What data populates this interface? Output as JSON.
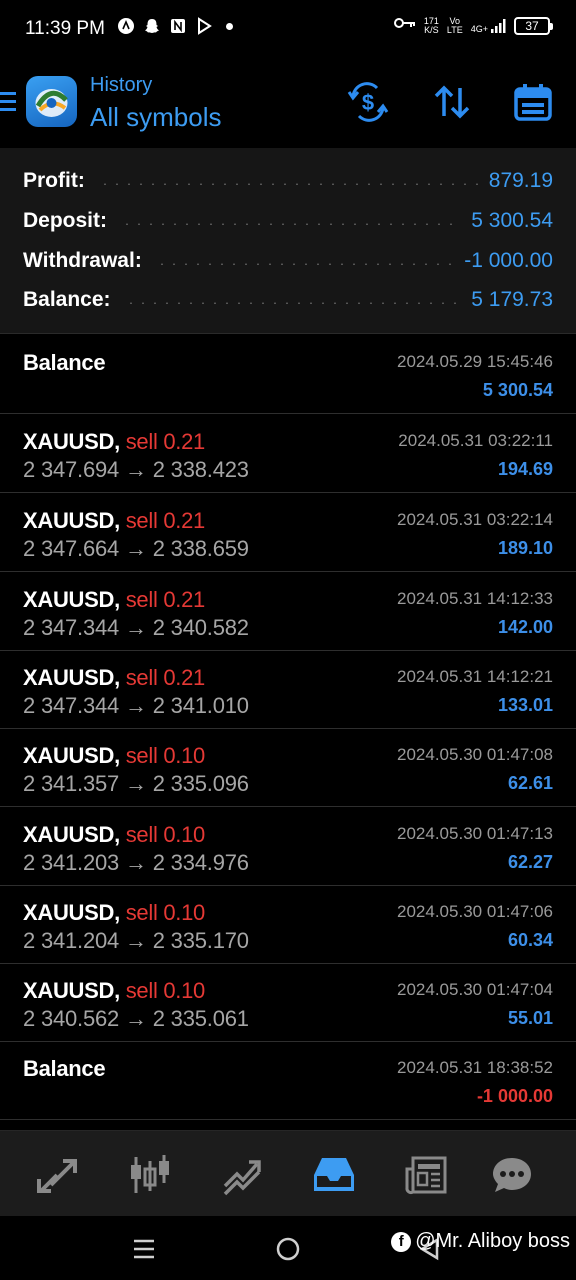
{
  "status_bar": {
    "time": "11:39 PM",
    "net_speed_top": "171",
    "net_speed_unit": "K/S",
    "volte_top": "Vo",
    "volte_bottom": "LTE",
    "network": "4G+",
    "battery": "37"
  },
  "header": {
    "subtitle": "History",
    "title": "All symbols"
  },
  "summary": [
    {
      "label": "Profit:",
      "value": "879.19"
    },
    {
      "label": "Deposit:",
      "value": "5 300.54"
    },
    {
      "label": "Withdrawal:",
      "value": "-1 000.00"
    },
    {
      "label": "Balance:",
      "value": "5 179.73"
    }
  ],
  "entries": [
    {
      "type": "balance",
      "title": "Balance",
      "date": "2024.05.29 15:45:46",
      "amount": "5 300.54"
    },
    {
      "type": "trade",
      "symbol": "XAUUSD,",
      "direction": "sell 0.21",
      "open_price": "2 347.694",
      "close_price": "2 338.423",
      "arrow": "→",
      "date": "2024.05.31 03:22:11",
      "profit": "194.69"
    },
    {
      "type": "trade",
      "symbol": "XAUUSD,",
      "direction": "sell 0.21",
      "open_price": "2 347.664",
      "close_price": "2 338.659",
      "arrow": "→",
      "date": "2024.05.31 03:22:14",
      "profit": "189.10"
    },
    {
      "type": "trade",
      "symbol": "XAUUSD,",
      "direction": "sell 0.21",
      "open_price": "2 347.344",
      "close_price": "2 340.582",
      "arrow": "→",
      "date": "2024.05.31 14:12:33",
      "profit": "142.00"
    },
    {
      "type": "trade",
      "symbol": "XAUUSD,",
      "direction": "sell 0.21",
      "open_price": "2 347.344",
      "close_price": "2 341.010",
      "arrow": "→",
      "date": "2024.05.31 14:12:21",
      "profit": "133.01"
    },
    {
      "type": "trade",
      "symbol": "XAUUSD,",
      "direction": "sell 0.10",
      "open_price": "2 341.357",
      "close_price": "2 335.096",
      "arrow": "→",
      "date": "2024.05.30 01:47:08",
      "profit": "62.61"
    },
    {
      "type": "trade",
      "symbol": "XAUUSD,",
      "direction": "sell 0.10",
      "open_price": "2 341.203",
      "close_price": "2 334.976",
      "arrow": "→",
      "date": "2024.05.30 01:47:13",
      "profit": "62.27"
    },
    {
      "type": "trade",
      "symbol": "XAUUSD,",
      "direction": "sell 0.10",
      "open_price": "2 341.204",
      "close_price": "2 335.170",
      "arrow": "→",
      "date": "2024.05.30 01:47:06",
      "profit": "60.34"
    },
    {
      "type": "trade",
      "symbol": "XAUUSD,",
      "direction": "sell 0.10",
      "open_price": "2 340.562",
      "close_price": "2 335.061",
      "arrow": "→",
      "date": "2024.05.30 01:47:04",
      "profit": "55.01"
    },
    {
      "type": "balance",
      "title": "Balance",
      "date": "2024.05.31 18:38:52",
      "amount": "-1 000.00"
    }
  ],
  "tabs": [
    {
      "icon": "quotes-icon",
      "active": false
    },
    {
      "icon": "chart-icon",
      "active": false
    },
    {
      "icon": "trade-icon",
      "active": false
    },
    {
      "icon": "history-icon",
      "active": true
    },
    {
      "icon": "news-icon",
      "active": false
    },
    {
      "icon": "messages-icon",
      "active": false
    }
  ],
  "watermark": "@Mr. Aliboy boss",
  "colors": {
    "accent": "#3d9cf2",
    "loss": "#e53935",
    "background": "#000000",
    "panel": "#161616"
  }
}
